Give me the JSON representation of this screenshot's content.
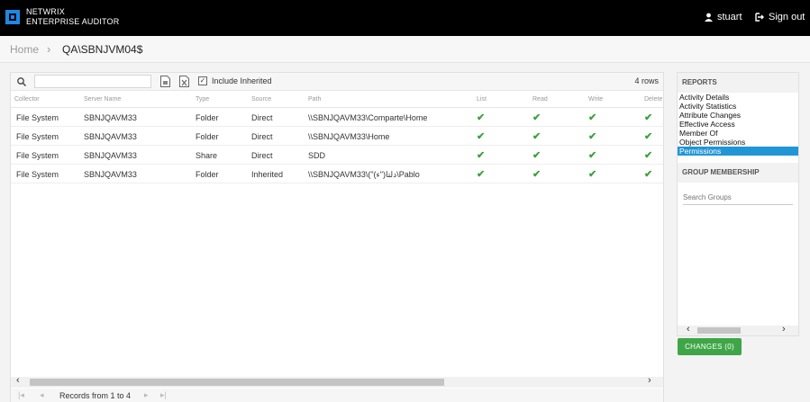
{
  "brand": {
    "line1": "NETWRIX",
    "line2": "ENTERPRISE AUDITOR"
  },
  "header": {
    "user": "stuart",
    "signout": "Sign out",
    "icons": {
      "user": "user-icon",
      "signout": "sign-out-icon"
    }
  },
  "breadcrumb": {
    "home": "Home",
    "separator": "›",
    "current": "QA\\SBNJVM04$"
  },
  "toolbar": {
    "search_value": "",
    "include_inherited": "Include Inherited",
    "include_inherited_checked": true,
    "rows": "4 rows"
  },
  "table": {
    "columns": [
      "Collector",
      "Server Name",
      "Type",
      "Source",
      "Path",
      "List",
      "Read",
      "Write",
      "Delete"
    ],
    "rows": [
      [
        "File System",
        "SBNJQAVM33",
        "Folder",
        "Direct",
        "\\\\SBNJQAVM33\\Comparte\\Home",
        "✔",
        "✔",
        "✔",
        "✔"
      ],
      [
        "File System",
        "SBNJQAVM33",
        "Folder",
        "Direct",
        "\\\\SBNJQAVM33\\Home",
        "✔",
        "✔",
        "✔",
        "✔"
      ],
      [
        "File System",
        "SBNJQAVM33",
        "Share",
        "Direct",
        "SDD",
        "✔",
        "✔",
        "✔",
        "✔"
      ],
      [
        "File System",
        "SBNJQAVM33",
        "Folder",
        "Inherited",
        "\\\\SBNJQAVM33\\(\"دلتا(\"ء)\\Pablo",
        "✔",
        "✔",
        "✔",
        "✔"
      ]
    ],
    "check_color": "#3aa23a"
  },
  "pager": {
    "first": "|◂",
    "prev": "◂",
    "next": "▸",
    "last": "▸|",
    "text": "Records from 1 to 4"
  },
  "reports": {
    "title": "REPORTS",
    "items": [
      "Activity Details",
      "Activity Statistics",
      "Attribute Changes",
      "Effective Access",
      "Member Of",
      "Object Permissions",
      "Permissions"
    ],
    "selected": "Permissions",
    "selected_color": "#2196d6"
  },
  "groups": {
    "title": "GROUP MEMBERSHIP",
    "search_placeholder": "Search Groups"
  },
  "changes_button": "CHANGES (0)",
  "colors": {
    "topbar": "#000000",
    "accent_green": "#3fa648"
  }
}
